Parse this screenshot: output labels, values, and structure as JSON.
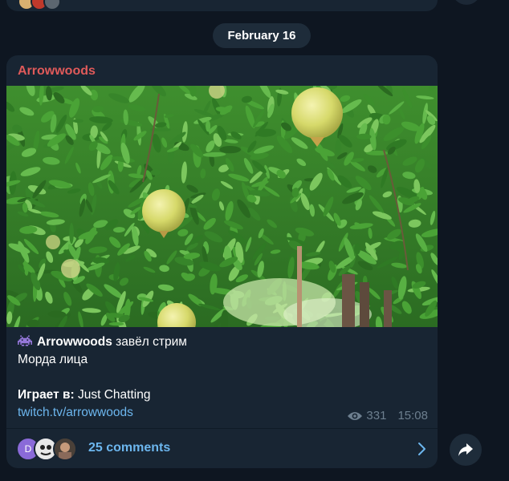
{
  "date_separator": "February 16",
  "post": {
    "sender": "Arrowwoods",
    "bot_line_name": "Arrowwoods",
    "bot_line_action": " завёл стрим",
    "line2": "Морда лица",
    "playing_label": "Играет в:",
    "playing_value": " Just Chatting",
    "link_text": "twitch.tv/arrowwoods",
    "views": "331",
    "time": "15:08",
    "comments_label": "25 comments",
    "commenter_initial": "D"
  },
  "colors": {
    "background": "#0e1621",
    "bubble": "#182533",
    "sender_name": "#e05a5a",
    "link": "#6cb6ee",
    "meta": "#6d7f8f"
  },
  "icons": [
    "space-invader-icon",
    "eye-icon",
    "chevron-right-icon",
    "share-arrow-icon"
  ]
}
